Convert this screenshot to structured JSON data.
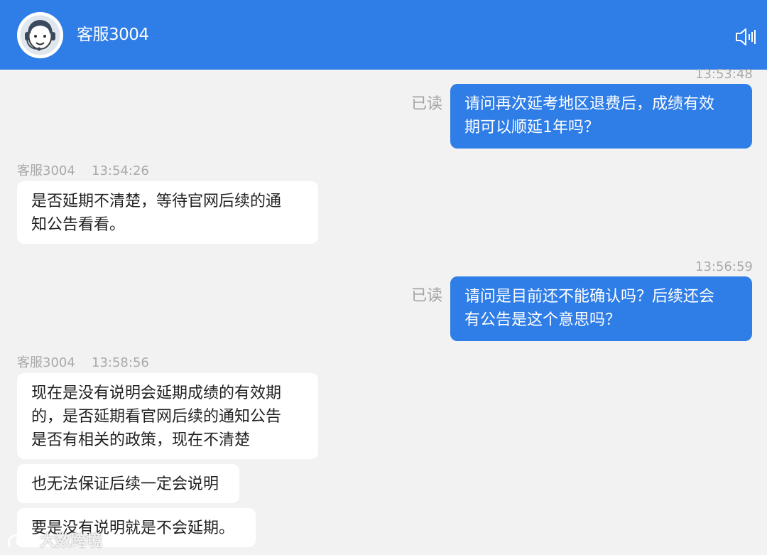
{
  "header": {
    "title": "客服3004",
    "avatar_icon": "support-agent-icon",
    "speaker_icon": "speaker-icon"
  },
  "messages": [
    {
      "side": "me",
      "time": "13:53:48",
      "status": "已读",
      "lines": [
        "请问再次延考地区退费后，成绩有效",
        "期可以顺延1年吗？"
      ]
    },
    {
      "side": "them",
      "sender": "客服3004",
      "time": "13:54:26",
      "lines": [
        "是否延期不清楚，等待官网后续的通",
        "知公告看看。"
      ]
    },
    {
      "side": "me",
      "time": "13:56:59",
      "status": "已读",
      "lines": [
        "请问是目前还不能确认吗？后续还会",
        "有公告是这个意思吗？"
      ]
    },
    {
      "side": "them",
      "sender": "客服3004",
      "time": "13:58:56",
      "lines": [
        "现在是没有说明会延期成绩的有效期",
        "的，是否延期看官网后续的通知公告",
        "是否有相关的政策，现在不清楚"
      ]
    },
    {
      "side": "them",
      "lines": [
        "也无法保证后续一定会说明"
      ]
    },
    {
      "side": "them",
      "lines": [
        "要是没有说明就是不会延期。"
      ]
    }
  ],
  "watermark": {
    "text": "大数跨境",
    "logo_icon": "watermark-logo-icon"
  },
  "colors": {
    "header": "#2f7de6",
    "background": "#f2f2f2",
    "bubble_me": "#2f7de6",
    "bubble_them": "#ffffff",
    "meta_text": "#a9a9a9"
  }
}
